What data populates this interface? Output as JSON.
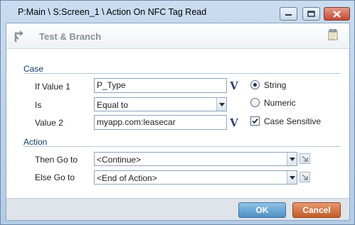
{
  "window": {
    "title": "P:Main \\ S:Screen_1 \\ Action On NFC Tag Read",
    "icons": {
      "minimize": "minimize-icon",
      "maximize": "maximize-icon",
      "close": "close-icon"
    }
  },
  "header": {
    "title": "Test & Branch",
    "icon": "branch-icon",
    "notes_icon": "notes-icon"
  },
  "case_section": {
    "label": "Case",
    "if_value1_label": "If Value 1",
    "if_value1_value": "P_Type",
    "is_label": "Is",
    "is_value": "Equal to",
    "value2_label": "Value 2",
    "value2_value": "myapp.com:leasecar",
    "variable_button": "V",
    "type_options": [
      {
        "label": "String",
        "selected": true
      },
      {
        "label": "Numeric",
        "selected": false
      }
    ],
    "case_sensitive_label": "Case Sensitive",
    "case_sensitive_checked": true
  },
  "action_section": {
    "label": "Action",
    "then_label": "Then Go to",
    "then_value": "<Continue>",
    "else_label": "Else Go to",
    "else_value": "<End of Action>"
  },
  "footer": {
    "ok_label": "OK",
    "cancel_label": "Cancel"
  },
  "colors": {
    "ok": "#4f8fc2",
    "cancel": "#c35a2a",
    "section": "#0f3a66"
  }
}
